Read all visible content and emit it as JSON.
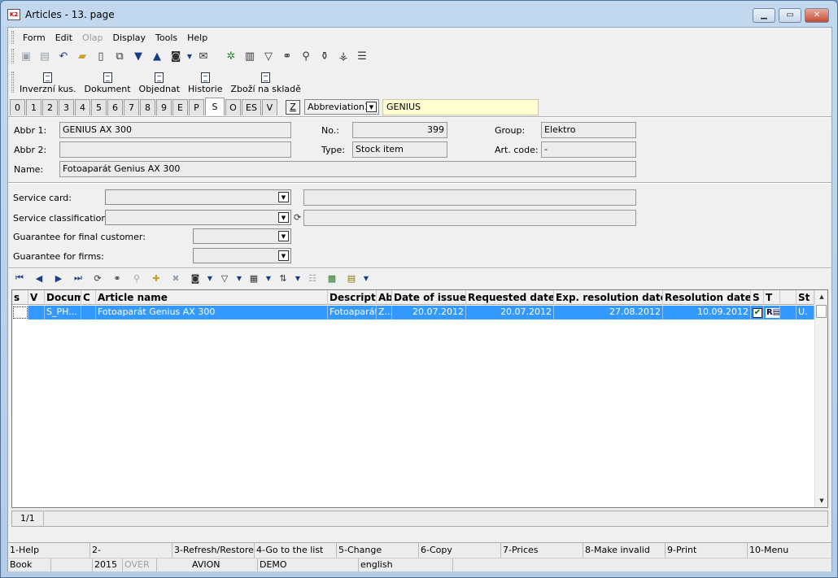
{
  "window": {
    "title": "Articles - 13. page",
    "app_icon": "K2"
  },
  "menu": [
    "Form",
    "Edit",
    "Olap",
    "Display",
    "Tools",
    "Help"
  ],
  "menu_disabled": [
    "Olap"
  ],
  "toolbar2": [
    "Inverzní kus.",
    "Dokument",
    "Objednat",
    "Historie",
    "Zboží na skladě"
  ],
  "tabs": [
    "0",
    "1",
    "2",
    "3",
    "4",
    "5",
    "6",
    "7",
    "8",
    "9",
    "E",
    "P",
    "S",
    "O",
    "ES",
    "V"
  ],
  "active_tab": "S",
  "search": {
    "z_label": "Z",
    "key_select": "Abbreviation1",
    "value": "GENIUS"
  },
  "header": {
    "abbr1_label": "Abbr 1:",
    "abbr1": "GENIUS AX 300",
    "abbr2_label": "Abbr 2:",
    "abbr2": "",
    "name_label": "Name:",
    "name": "Fotoaparát Genius AX 300",
    "no_label": "No.:",
    "no": "399",
    "type_label": "Type:",
    "type": "Stock item",
    "group_label": "Group:",
    "group": "Elektro",
    "artcode_label": "Art. code:",
    "artcode": "-"
  },
  "service": {
    "card_label": "Service card:",
    "classification_label": "Service classification:",
    "guarantee_customer_label": "Guarantee for final customer:",
    "guarantee_firms_label": "Guarantee for firms:"
  },
  "grid": {
    "columns": [
      "s",
      "V",
      "Docum",
      "C",
      "Article name",
      "Descripti",
      "Ab",
      "Date of issue",
      "Requested date",
      "Exp. resolution date",
      "Resolution date",
      "S",
      "T",
      "",
      "St"
    ],
    "row": {
      "s": "",
      "v": "",
      "docum": "S_PH...",
      "c": "",
      "article": "Fotoaparát Genius AX 300",
      "descr": "Fotoaparát",
      "ab": "Z...",
      "issue": "20.07.2012",
      "requested": "20.07.2012",
      "exp_res": "27.08.2012",
      "resolution": "10.09.2012",
      "s2": "✔",
      "t": "R▤",
      "st": "U."
    }
  },
  "pager": {
    "count": "1/1"
  },
  "fkeys": [
    "1-Help",
    "2-",
    "3-Refresh/Restore",
    "4-Go to the list",
    "5-Change",
    "6-Copy",
    "7-Prices",
    "8-Make invalid",
    "9-Print",
    "10-Menu"
  ],
  "status": {
    "book": "Book",
    "year": "2015",
    "over": "OVER",
    "db": "AVION",
    "mode": "DEMO",
    "lang": "english"
  }
}
